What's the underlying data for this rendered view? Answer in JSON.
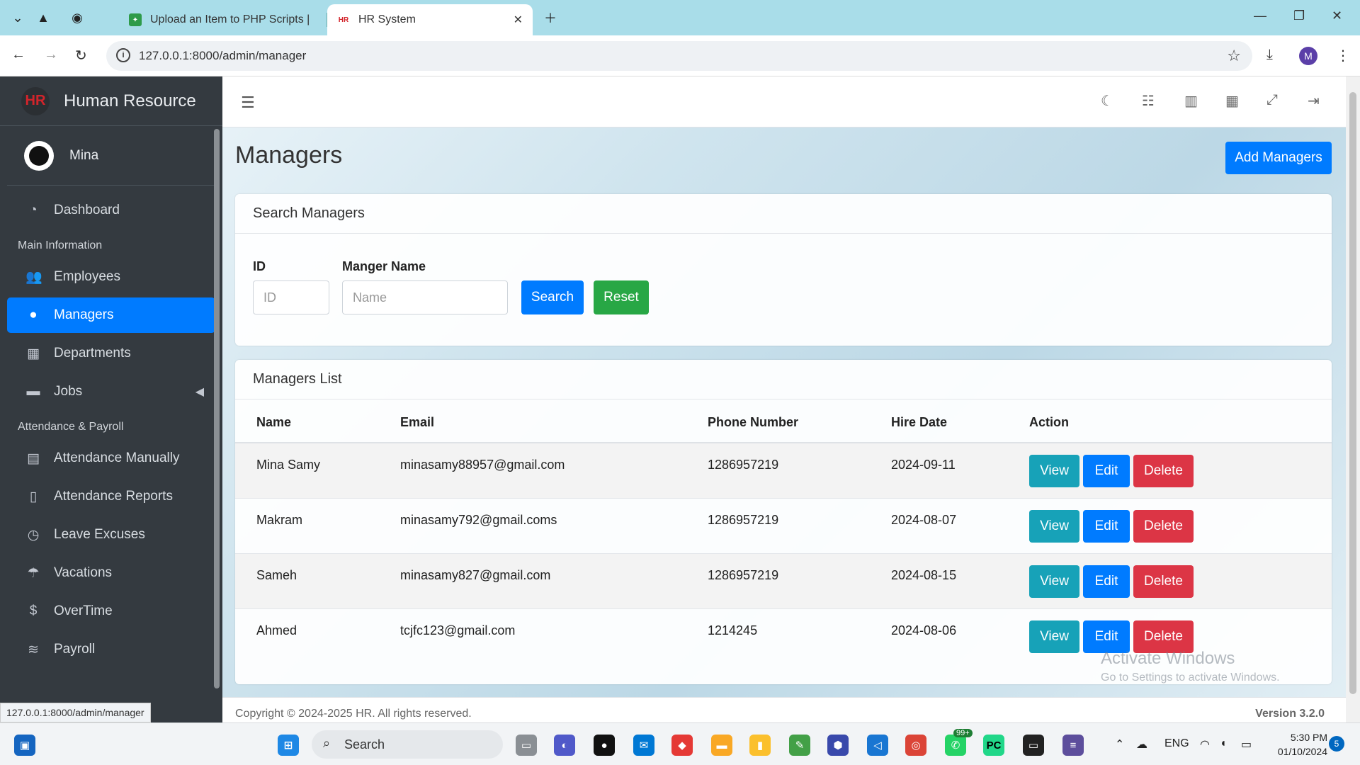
{
  "browser": {
    "tabs": [
      {
        "title": "Upload an Item to PHP Scripts |",
        "active": false
      },
      {
        "title": "HR System",
        "active": true
      }
    ],
    "url": "127.0.0.1:8000/admin/manager",
    "profile_initial": "M",
    "status_url": "127.0.0.1:8000/admin/manager"
  },
  "sidebar": {
    "brand": "Human Resource",
    "brand_logo": "HR",
    "user": "Mina",
    "sections": {
      "main_info": "Main Information",
      "attendance": "Attendance & Payroll"
    },
    "items": [
      {
        "label": "Dashboard",
        "icon": "dashboard-icon"
      },
      {
        "label": "Employees",
        "icon": "users-icon"
      },
      {
        "label": "Managers",
        "icon": "user-icon"
      },
      {
        "label": "Departments",
        "icon": "building-icon"
      },
      {
        "label": "Jobs",
        "icon": "briefcase-icon"
      },
      {
        "label": "Attendance Manually",
        "icon": "calendar-icon"
      },
      {
        "label": "Attendance Reports",
        "icon": "file-icon"
      },
      {
        "label": "Leave Excuses",
        "icon": "clock-icon"
      },
      {
        "label": "Vacations",
        "icon": "umbrella-beach-icon"
      },
      {
        "label": "OverTime",
        "icon": "dollar-icon"
      },
      {
        "label": "Payroll",
        "icon": "coins-icon"
      }
    ]
  },
  "page": {
    "title": "Managers",
    "add_button": "Add Managers",
    "search": {
      "card_title": "Search Managers",
      "id_label": "ID",
      "id_placeholder": "ID",
      "name_label": "Manger Name",
      "name_placeholder": "Name",
      "search_button": "Search",
      "reset_button": "Reset"
    },
    "list": {
      "card_title": "Managers List",
      "columns": [
        "Name",
        "Email",
        "Phone Number",
        "Hire Date",
        "Action"
      ],
      "rows": [
        {
          "name": "Mina Samy",
          "email": "minasamy88957@gmail.com",
          "phone": "1286957219",
          "hire_date": "2024-09-11"
        },
        {
          "name": "Makram",
          "email": "minasamy792@gmail.coms",
          "phone": "1286957219",
          "hire_date": "2024-08-07"
        },
        {
          "name": "Sameh",
          "email": "minasamy827@gmail.com",
          "phone": "1286957219",
          "hire_date": "2024-08-15"
        },
        {
          "name": "Ahmed",
          "email": "tcjfc123@gmail.com",
          "phone": "1214245",
          "hire_date": "2024-08-06"
        }
      ],
      "actions": {
        "view": "View",
        "edit": "Edit",
        "delete": "Delete"
      }
    },
    "watermark": {
      "line1": "Activate Windows",
      "line2": "Go to Settings to activate Windows."
    },
    "footer": {
      "left": "Copyright © 2024-2025 HR. All rights reserved.",
      "right": "Version 3.2.0"
    }
  },
  "taskbar": {
    "search": "Search",
    "whatsapp_badge": "99+",
    "lang": "ENG",
    "time": "5:30 PM",
    "date": "01/10/2024",
    "notif_count": "5"
  },
  "colors": {
    "primary": "#007bff",
    "success": "#28a745",
    "info": "#17a2b8",
    "danger": "#dc3545",
    "sidebar": "#343a40"
  }
}
